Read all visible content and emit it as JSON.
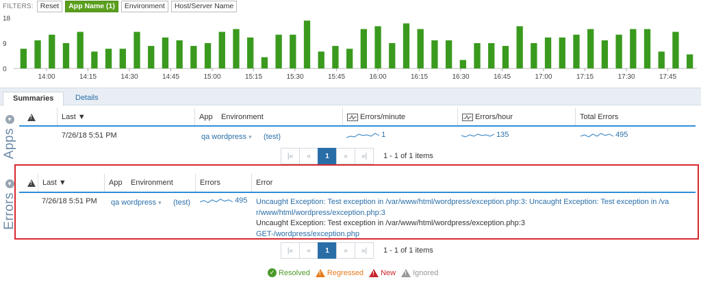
{
  "filters": {
    "label": "FILTERS:",
    "buttons": [
      "Reset",
      "App Name (1)",
      "Environment",
      "Host/Server Name"
    ],
    "active_index": 1
  },
  "chart_data": {
    "type": "bar",
    "color": "#3a9a1e",
    "ylim": [
      0,
      18
    ],
    "y_ticks": [
      "18",
      "9",
      "0"
    ],
    "x_ticks": [
      "14:00",
      "14:15",
      "14:30",
      "14:45",
      "15:00",
      "15:15",
      "15:30",
      "15:45",
      "16:00",
      "16:15",
      "16:30",
      "16:45",
      "17:00",
      "17:15",
      "17:30",
      "17:45"
    ],
    "values": [
      7,
      10,
      12,
      9,
      13,
      6,
      7,
      7,
      13,
      8,
      11,
      10,
      8,
      9,
      13,
      14,
      11,
      4,
      12,
      12,
      17,
      6,
      8,
      7,
      14,
      15,
      9,
      16,
      14,
      10,
      10,
      3,
      9,
      9,
      8,
      15,
      9,
      11,
      11,
      12,
      14,
      10,
      12,
      14,
      14,
      6,
      13,
      5
    ]
  },
  "tabs": [
    "Summaries",
    "Details"
  ],
  "apps": {
    "section_label": "Apps",
    "columns": [
      "Last ▼",
      "App",
      "Environment",
      "Errors/minute",
      "Errors/hour",
      "Total Errors"
    ],
    "row": {
      "last": "7/26/18 5:51 PM",
      "app": "qa wordpress",
      "environment": "(test)",
      "errors_minute": "1",
      "errors_hour": "135",
      "total_errors": "495"
    },
    "pager": {
      "first": "|«",
      "prev": "«",
      "page": "1",
      "next": "»",
      "last": "»|",
      "info": "1 - 1 of 1 items"
    }
  },
  "errors": {
    "section_label": "Errors",
    "columns": [
      "Last ▼",
      "App",
      "Environment",
      "Errors",
      "Error"
    ],
    "row": {
      "last": "7/26/18 5:51 PM",
      "app": "qa wordpress",
      "environment": "(test)",
      "errors": "495",
      "error_line1": "Uncaught Exception: Test exception in /var/www/html/wordpress/exception.php:3: Uncaught Exception: Test exception in /va",
      "error_line2": "r/www/html/wordpress/exception.php:3",
      "error_line3": "Uncaught Exception: Test exception in /var/www/html/wordpress/exception.php:3",
      "error_line4": "GET-/wordpress/exception.php"
    },
    "pager": {
      "first": "|«",
      "prev": "«",
      "page": "1",
      "next": "»",
      "last": "»|",
      "info": "1 - 1 of 1 items"
    }
  },
  "legend": {
    "resolved": "Resolved",
    "regressed": "Regressed",
    "new": "New",
    "ignored": "Ignored",
    "colors": {
      "resolved": "#4b9a2a",
      "regressed": "#e67b1c",
      "new": "#c8252c",
      "ignored": "#999999"
    }
  }
}
